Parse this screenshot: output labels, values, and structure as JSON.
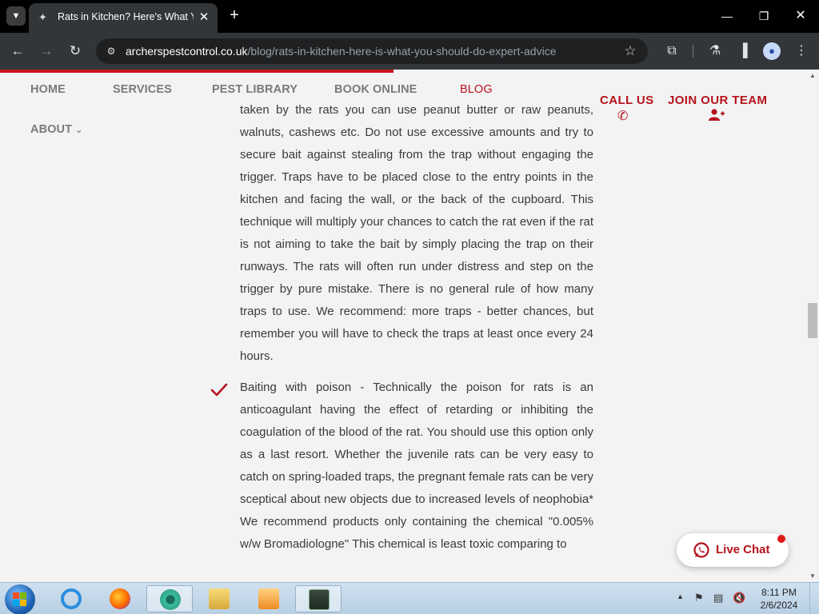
{
  "browser": {
    "tab_title": "Rats in Kitchen? Here's What You Should Do",
    "url_host": "archerspestcontrol.co.uk",
    "url_path": "/blog/rats-in-kitchen-here-is-what-you-should-do-expert-advice"
  },
  "nav": {
    "home": "HOME",
    "services": "SERVICES",
    "pest_library": "PEST LIBRARY",
    "book_online": "BOOK ONLINE",
    "blog": "BLOG",
    "about": "ABOUT",
    "call_us": "CALL US",
    "join_team": "JOIN OUR TEAM"
  },
  "article": {
    "para1": "taken by the rats you can use peanut butter or raw peanuts, walnuts, cashews etc. Do not use excessive amounts and try to secure bait against stealing from the trap without engaging the trigger. Traps have to be placed close to the entry points in the kitchen and facing the wall, or the back of the cupboard. This technique will multiply your chances to catch the rat even if the rat is not aiming to take the bait by simply placing the trap on their runways. The rats will often run under distress and step on the trigger by pure mistake. There is no general rule of how many traps to use. We recommend: more traps - better chances, but remember you will have to check the traps at least once every 24 hours.",
    "para2": "Baiting with poison - Technically the poison for rats is an anticoagulant having the effect of retarding or inhibiting the coagulation of the blood of the rat. You should use this option only as a last resort. Whether the juvenile rats can be very easy to catch on spring-loaded traps, the pregnant female rats can be very sceptical about new objects due to increased levels of neophobia* We recommend products only containing the chemical \"0.005% w/w Bromadiologne\" This chemical is least toxic comparing to"
  },
  "live_chat": {
    "label": "Live Chat"
  },
  "taskbar": {
    "time": "8:11 PM",
    "date": "2/6/2024"
  },
  "colors": {
    "brand_red": "#b5121b",
    "nav_gray": "#7a7a7a",
    "text": "#3a3a3a"
  }
}
